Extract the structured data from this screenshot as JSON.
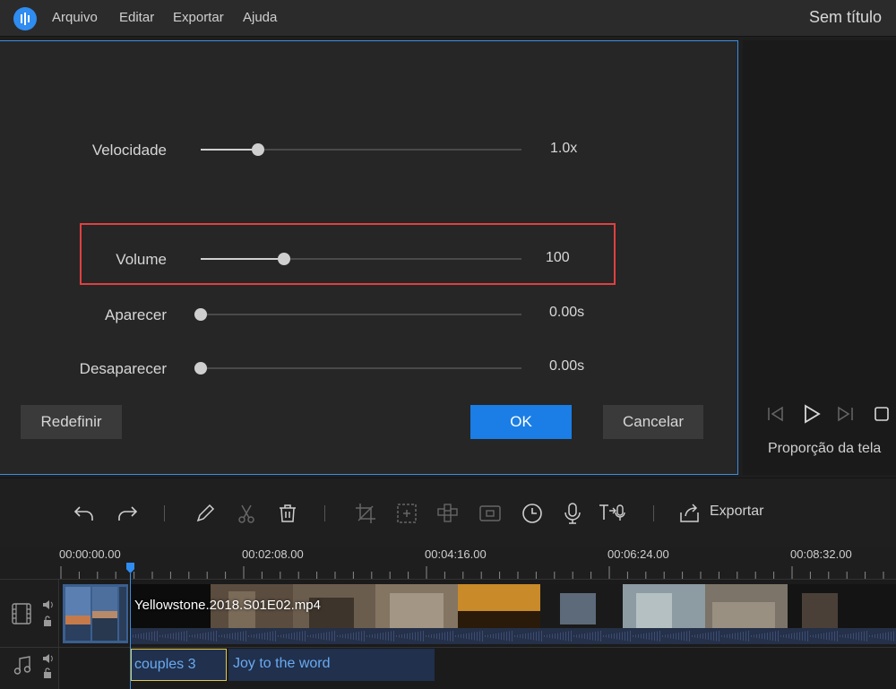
{
  "menu": {
    "items": [
      "Arquivo",
      "Editar",
      "Exportar",
      "Ajuda"
    ],
    "document_title": "Sem título"
  },
  "dialog": {
    "sliders": [
      {
        "label": "Velocidade",
        "value": "1.0x",
        "level": 0.18
      },
      {
        "label": "Volume",
        "value": "100",
        "level": 0.26
      },
      {
        "label": "Aparecer",
        "value": "0.00s",
        "level": 0.0
      },
      {
        "label": "Desaparecer",
        "value": "0.00s",
        "level": 0.0
      }
    ],
    "buttons": {
      "reset": "Redefinir",
      "ok": "OK",
      "cancel": "Cancelar"
    }
  },
  "preview": {
    "aspect_label": "Proporção da tela"
  },
  "toolbar": {
    "export_label": "Exportar",
    "tools": [
      "undo-icon",
      "redo-icon",
      "pencil-icon",
      "scissors-icon",
      "trash-icon",
      "crop-icon",
      "resize-icon",
      "mosaic-icon",
      "freeze-icon",
      "clock-icon",
      "microphone-icon",
      "text-to-speech-icon",
      "export-icon"
    ]
  },
  "timeline": {
    "timecodes": [
      "00:00:00.00",
      "00:02:08.00",
      "00:04:16.00",
      "00:06:24.00",
      "00:08:32.00"
    ],
    "video_clip": "Yellowstone.2018.S01E02.mp4",
    "audio_clips": [
      "couples 3",
      "Joy to the word"
    ]
  },
  "colors": {
    "accent": "#1a7ee6",
    "highlight": "#e04040",
    "clip_selected_border": "#e3c94a"
  }
}
